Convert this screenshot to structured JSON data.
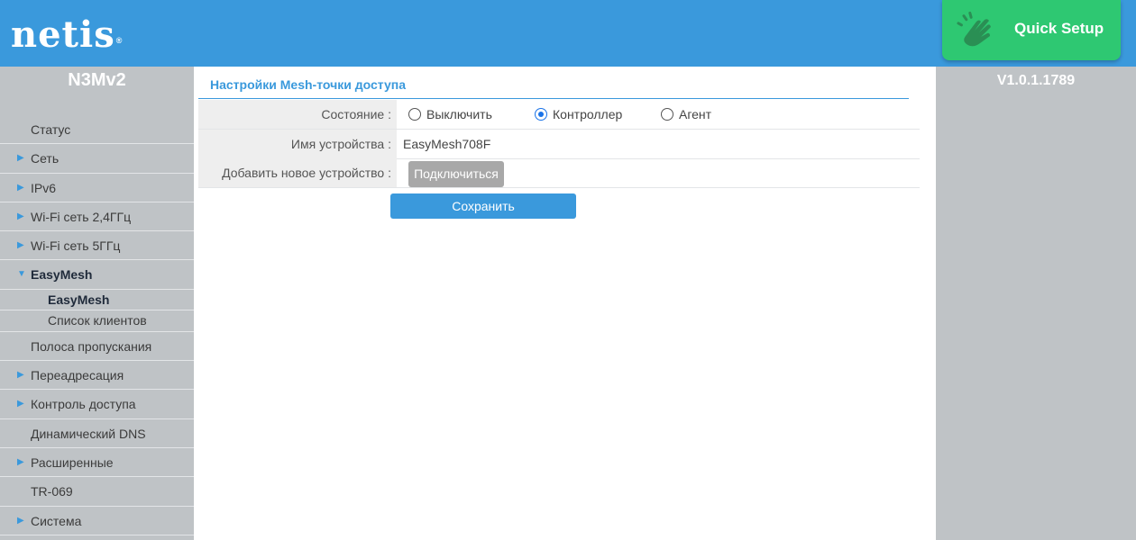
{
  "header": {
    "logo_text": "netis",
    "logo_reg": "®",
    "quick_setup_label": "Quick Setup",
    "quick_setup_icon": "hand-wave-icon",
    "accent_color": "#3a99dc",
    "quick_setup_color": "#2ec872"
  },
  "sidebar": {
    "model": "N3Mv2",
    "items": [
      {
        "label": "Статус",
        "arrow": false
      },
      {
        "label": "Сеть",
        "arrow": true
      },
      {
        "label": "IPv6",
        "arrow": true
      },
      {
        "label": "Wi-Fi сеть 2,4ГГц",
        "arrow": true
      },
      {
        "label": "Wi-Fi сеть 5ГГц",
        "arrow": true
      },
      {
        "label": "EasyMesh",
        "arrow": true,
        "expanded": true
      },
      {
        "label": "Полоса пропускания",
        "arrow": false
      },
      {
        "label": "Переадресация",
        "arrow": true
      },
      {
        "label": "Контроль доступа",
        "arrow": true
      },
      {
        "label": "Динамический DNS",
        "arrow": false
      },
      {
        "label": "Расширенные",
        "arrow": true
      },
      {
        "label": "TR-069",
        "arrow": false
      },
      {
        "label": "Система",
        "arrow": true
      }
    ],
    "subitems": [
      {
        "label": "EasyMesh",
        "active": true
      },
      {
        "label": "Список клиентов",
        "active": false
      }
    ],
    "arrow_right": "▶",
    "arrow_down": "▼"
  },
  "right_panel": {
    "version": "V1.0.1.1789"
  },
  "main": {
    "section_title": "Настройки Mesh-точки доступа",
    "state": {
      "label": "Состояние :",
      "options": [
        "Выключить",
        "Контроллер",
        "Агент"
      ],
      "selected": "Контроллер"
    },
    "device_name": {
      "label": "Имя устройства :",
      "value": "EasyMesh708F"
    },
    "add_device": {
      "label": "Добавить новое устройство :",
      "button": "Подключиться"
    },
    "save_button": "Сохранить"
  }
}
